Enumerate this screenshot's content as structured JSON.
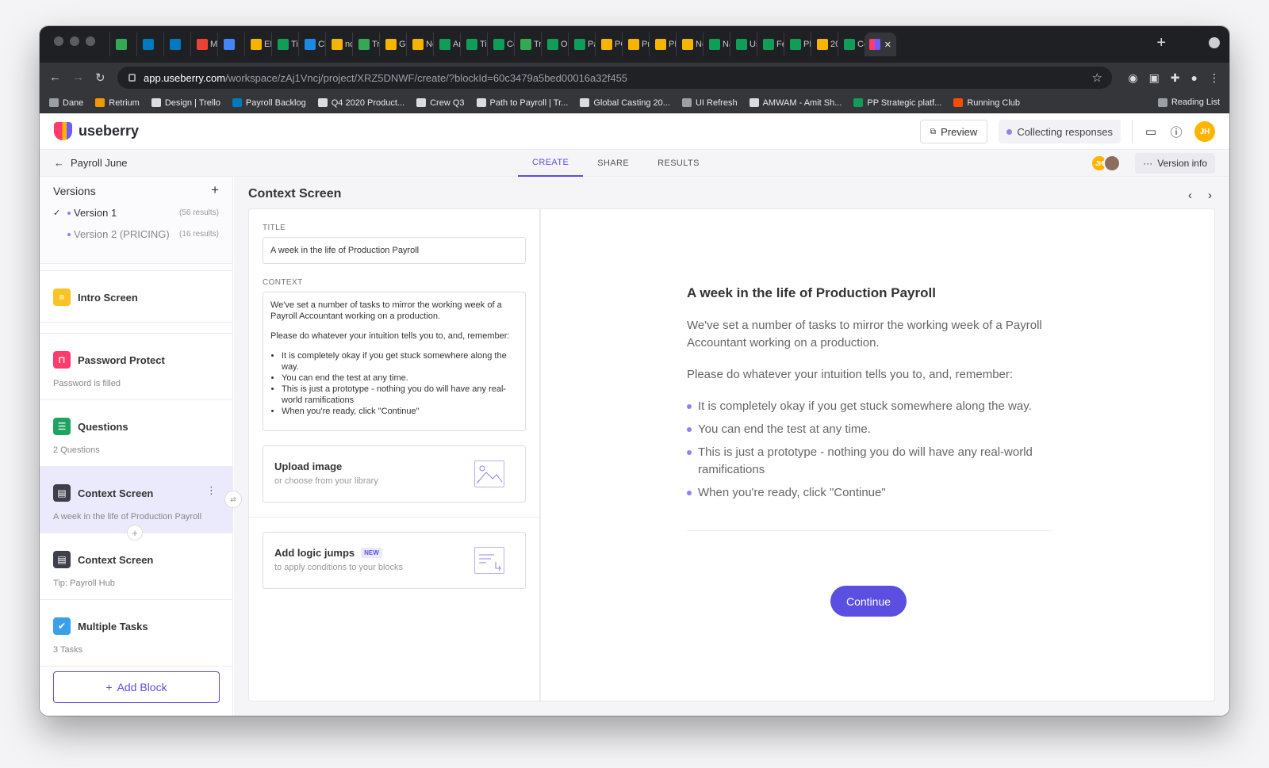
{
  "browser": {
    "tabs": [
      {
        "label": "",
        "color": "#34a853"
      },
      {
        "label": "",
        "color": "#0079bf"
      },
      {
        "label": "",
        "color": "#0079bf"
      },
      {
        "label": "M",
        "color": "#ea4335"
      },
      {
        "label": "",
        "color": "#4285f4"
      },
      {
        "label": "EF",
        "color": "#f4b400"
      },
      {
        "label": "Ti",
        "color": "#0f9d58"
      },
      {
        "label": "Ch",
        "color": "#1e88e5"
      },
      {
        "label": "nc",
        "color": "#f4b400"
      },
      {
        "label": "Tr",
        "color": "#34a853"
      },
      {
        "label": "Gc",
        "color": "#f4b400"
      },
      {
        "label": "Nc",
        "color": "#f4b400"
      },
      {
        "label": "Ar",
        "color": "#0f9d58"
      },
      {
        "label": "Tir",
        "color": "#0f9d58"
      },
      {
        "label": "Cc",
        "color": "#0f9d58"
      },
      {
        "label": "Tr",
        "color": "#34a853"
      },
      {
        "label": "Or",
        "color": "#0f9d58"
      },
      {
        "label": "Pa",
        "color": "#0f9d58"
      },
      {
        "label": "PC",
        "color": "#f4b400"
      },
      {
        "label": "Pr",
        "color": "#f4b400"
      },
      {
        "label": "PF",
        "color": "#f4b400"
      },
      {
        "label": "Nc",
        "color": "#f4b400"
      },
      {
        "label": "Na",
        "color": "#0f9d58"
      },
      {
        "label": "Us",
        "color": "#0f9d58"
      },
      {
        "label": "Fe",
        "color": "#0f9d58"
      },
      {
        "label": "PF",
        "color": "#0f9d58"
      },
      {
        "label": "20",
        "color": "#f4b400"
      },
      {
        "label": "Cc",
        "color": "#0f9d58"
      }
    ],
    "url_host": "app.useberry.com",
    "url_path": "/workspace/zAj1Vncj/project/XRZ5DNWF/create/?blockId=60c3479a5bed00016a32f455",
    "bookmarks": [
      {
        "label": "Dane",
        "color": "#9aa0a6"
      },
      {
        "label": "Retrium",
        "color": "#f29900"
      },
      {
        "label": "Design | Trello",
        "color": "#dadce0"
      },
      {
        "label": "Payroll Backlog",
        "color": "#0079bf"
      },
      {
        "label": "Q4 2020 Product...",
        "color": "#dadce0"
      },
      {
        "label": "Crew Q3",
        "color": "#dadce0"
      },
      {
        "label": "Path to Payroll | Tr...",
        "color": "#dadce0"
      },
      {
        "label": "Global Casting 20...",
        "color": "#dadce0"
      },
      {
        "label": "UI Refresh",
        "color": "#9aa0a6"
      },
      {
        "label": "AMWAM - Amit Sh...",
        "color": "#dadce0"
      },
      {
        "label": "PP Strategic platf...",
        "color": "#0f9d58"
      },
      {
        "label": "Running Club",
        "color": "#fc4c02"
      }
    ],
    "reading_list": "Reading List"
  },
  "app": {
    "brand": "useberry",
    "preview_label": "Preview",
    "status_label": "Collecting responses",
    "user_initials": "JH",
    "back_label": "Payroll June",
    "tabs": [
      "CREATE",
      "SHARE",
      "RESULTS"
    ],
    "version_info": "Version info"
  },
  "sidebar": {
    "versions_title": "Versions",
    "versions": [
      {
        "name": "Version 1",
        "count": "(56 results)"
      },
      {
        "name": "Version 2 (PRICING)",
        "count": "(16 results)"
      }
    ],
    "blocks": [
      {
        "title": "Intro Screen",
        "desc": "",
        "color": "#f7c325",
        "icon": "≡"
      },
      {
        "title": "Password Protect",
        "desc": "Password is filled",
        "color": "#ff3b6b",
        "icon": "🔒"
      },
      {
        "title": "Questions",
        "desc": "2 Questions",
        "color": "#1ea362",
        "icon": "☰"
      },
      {
        "title": "Context Screen",
        "desc": "A week in the life of Production Payroll",
        "color": "#3d3f4a",
        "icon": "▤"
      },
      {
        "title": "Context Screen",
        "desc": "Tip: Payroll Hub",
        "color": "#3d3f4a",
        "icon": "▤"
      },
      {
        "title": "Multiple Tasks",
        "desc": "3 Tasks",
        "color": "#3aa0e8",
        "icon": "✔"
      }
    ],
    "add_block": "Add Block"
  },
  "editor": {
    "screen_title": "Context Screen",
    "title_label": "TITLE",
    "title_value": "A week in the life of Production Payroll",
    "context_label": "CONTEXT",
    "context_p1": "We've set a number of tasks to mirror the working week of a Payroll Accountant working on a production.",
    "context_p2": "Please do whatever your intuition tells you to, and, remember:",
    "context_bullets": [
      "It is completely okay if you get stuck somewhere along the way.",
      "You can end the test at any time.",
      "This is just a prototype - nothing you do will have any real-world ramifications",
      "When you're ready, click \"Continue\""
    ],
    "upload_title": "Upload image",
    "upload_sub": "or choose from your library",
    "logic_title": "Add logic jumps",
    "logic_badge": "NEW",
    "logic_sub": "to apply conditions to your blocks"
  },
  "preview": {
    "title": "A week in the life of Production Payroll",
    "p1": "We've set a number of tasks to mirror the working week of a Payroll Accountant working on a production.",
    "p2": "Please do whatever your intuition tells you to, and, remember:",
    "bullets": [
      "It is completely okay if you get stuck somewhere along the way.",
      "You can end the test at any time.",
      "This is just a prototype - nothing you do will have any real-world ramifications",
      "When you're ready, click \"Continue\""
    ],
    "continue_label": "Continue"
  },
  "colors": {
    "accent": "#5a4fe0",
    "sidebar_active": "#ebeafc"
  }
}
